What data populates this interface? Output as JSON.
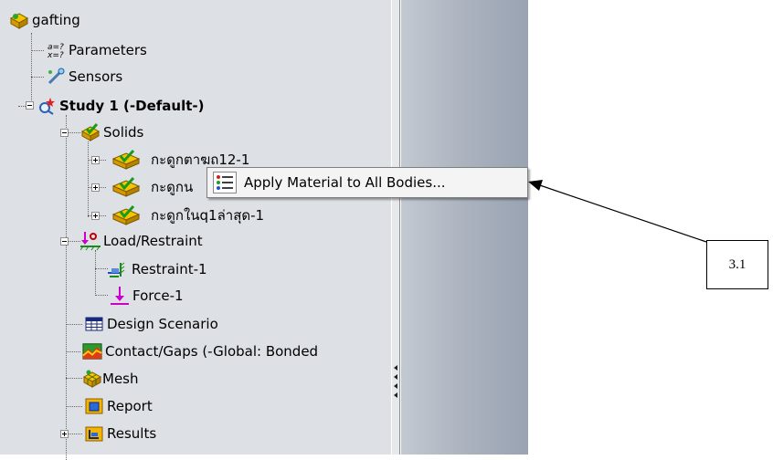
{
  "tree": {
    "root": {
      "label": "gafting",
      "icon": "part-icon"
    },
    "parameters": {
      "label": "Parameters",
      "icon": "parameters-icon"
    },
    "sensors": {
      "label": "Sensors",
      "icon": "sensors-icon"
    },
    "study": {
      "label": "Study 1 (-Default-)",
      "icon": "study-icon"
    },
    "solids": {
      "label": "Solids",
      "icon": "solids-icon"
    },
    "solid_items": [
      {
        "label": "กะดูกตาฆถ12-1",
        "icon": "solid-body-icon"
      },
      {
        "label": "กะดูกน",
        "icon": "solid-body-icon"
      },
      {
        "label": "กะดูกในq1ล่าสุด-1",
        "icon": "solid-body-icon"
      }
    ],
    "load_restraint": {
      "label": "Load/Restraint",
      "icon": "load-restraint-icon"
    },
    "restraint": {
      "label": "Restraint-1",
      "icon": "restraint-icon"
    },
    "force": {
      "label": "Force-1",
      "icon": "force-arrow-icon"
    },
    "design_scenario": {
      "label": "Design Scenario",
      "icon": "table-icon"
    },
    "contact": {
      "label": "Contact/Gaps (-Global: Bonded",
      "icon": "contact-icon"
    },
    "mesh": {
      "label": "Mesh",
      "icon": "mesh-icon"
    },
    "report": {
      "label": "Report",
      "icon": "report-icon"
    },
    "results": {
      "label": "Results",
      "icon": "results-folder-icon"
    }
  },
  "context_menu": {
    "items": [
      {
        "label": "Apply Material to All Bodies...",
        "icon": "material-list-icon"
      }
    ]
  },
  "callout": {
    "label": "3.1"
  },
  "colors": {
    "panel_bg": "#dde0e4",
    "graphics_bg": "#a9b1bd",
    "force_color": "#cc00cc",
    "folder_color": "#f5b400"
  }
}
